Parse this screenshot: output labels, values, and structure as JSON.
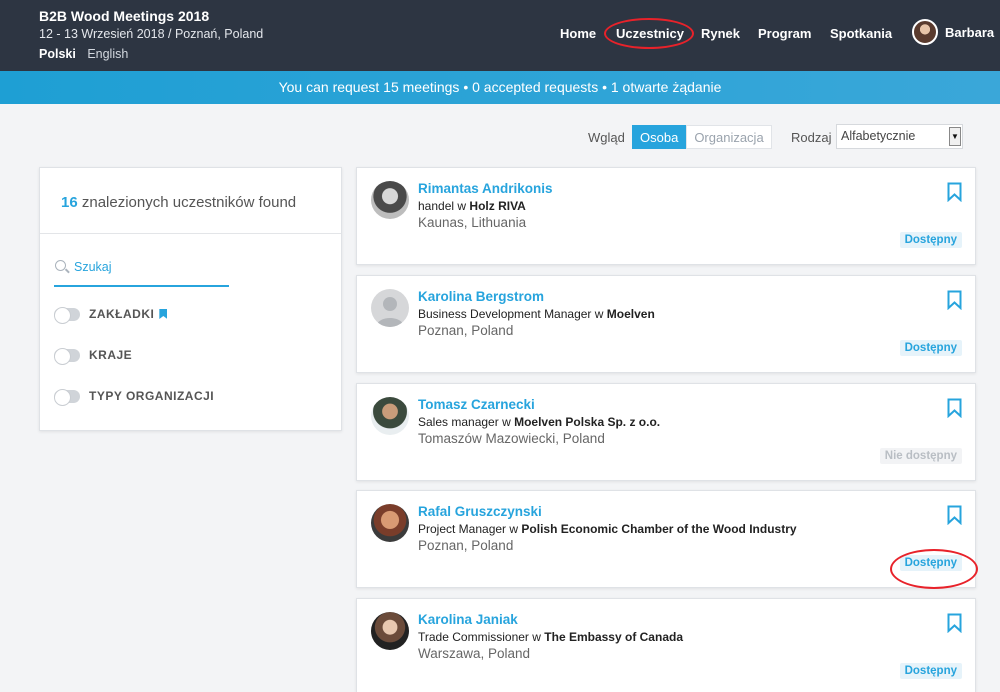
{
  "event": {
    "title": "B2B Wood Meetings 2018",
    "date_location": "12 - 13 Wrzesień 2018 / Poznań, Poland",
    "languages": [
      "Polski",
      "English"
    ]
  },
  "nav": {
    "items": [
      "Home",
      "Uczestnicy",
      "Rynek",
      "Program",
      "Spotkania"
    ],
    "user_name": "Barbara"
  },
  "banner": {
    "text": "You can request 15 meetings • 0 accepted requests • 1 otwarte żądanie"
  },
  "view": {
    "label": "Wgląd",
    "options": [
      "Osoba",
      "Organizacja"
    ],
    "sort_label": "Rodzaj",
    "sort_value": "Alfabetycznie"
  },
  "filters": {
    "count": "16",
    "found_text": "znalezionych uczestników found",
    "search_placeholder": "Szukaj",
    "items": [
      "ZAKŁADKI",
      "KRAJE",
      "TYPY ORGANIZACJI"
    ]
  },
  "participants": [
    {
      "name": "Rimantas Andrikonis",
      "role": "handel",
      "connector": "w",
      "org": "Holz RIVA",
      "location": "Kaunas, Lithuania",
      "status": "Dostępny"
    },
    {
      "name": "Karolina Bergstrom",
      "role": "Business Development Manager",
      "connector": "w",
      "org": "Moelven",
      "location": "Poznan, Poland",
      "status": "Dostępny"
    },
    {
      "name": "Tomasz Czarnecki",
      "role": "Sales manager",
      "connector": "w",
      "org": "Moelven Polska Sp. z o.o.",
      "location": "Tomaszów Mazowiecki, Poland",
      "status": "Nie dostępny"
    },
    {
      "name": "Rafal Gruszczynski",
      "role": "Project Manager",
      "connector": "w",
      "org": "Polish Economic Chamber of the Wood Industry",
      "location": "Poznan, Poland",
      "status": "Dostępny"
    },
    {
      "name": "Karolina Janiak",
      "role": "Trade Commissioner",
      "connector": "w",
      "org": "The Embassy of Canada",
      "location": "Warszawa, Poland",
      "status": "Dostępny"
    }
  ],
  "colors": {
    "header_bg": "#2d3542",
    "accent": "#27a4dd",
    "highlight_circle": "#e8222a"
  }
}
